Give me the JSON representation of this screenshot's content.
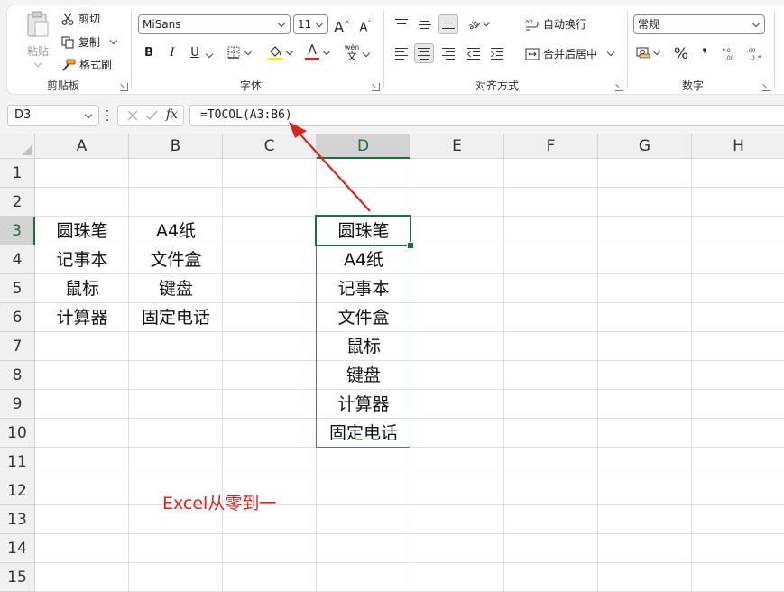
{
  "ribbon": {
    "clipboard": {
      "paste_label": "粘贴",
      "cut_label": "剪切",
      "copy_label": "复制",
      "format_painter_label": "格式刷",
      "group_label": "剪贴板"
    },
    "font": {
      "font_name": "MiSans",
      "font_size": "11",
      "grow_label": "A",
      "shrink_label": "A",
      "bold_label": "B",
      "italic_label": "I",
      "underline_label": "U",
      "font_color_glyph": "A",
      "phonetic_glyph": "wén",
      "phonetic_sub": "文",
      "group_label": "字体",
      "fill_color": "#FFE600",
      "font_color": "#E02020"
    },
    "alignment": {
      "wrap_text_label": "自动换行",
      "merge_center_label": "合并后居中",
      "group_label": "对齐方式"
    },
    "number": {
      "format_value": "常规",
      "percent_label": "%",
      "comma_label": "❜",
      "group_label": "数字"
    }
  },
  "formula_bar": {
    "name_box": "D3",
    "fx_label": "fx",
    "formula": "=TOCOL(A3:B6)"
  },
  "grid": {
    "columns": [
      "A",
      "B",
      "C",
      "D",
      "E",
      "F",
      "G",
      "H"
    ],
    "rows": [
      "1",
      "2",
      "3",
      "4",
      "5",
      "6",
      "7",
      "8",
      "9",
      "10",
      "11",
      "12",
      "13",
      "14",
      "15"
    ],
    "active_column": "D",
    "active_row": "3",
    "source_table": [
      [
        "圆珠笔",
        "A4纸"
      ],
      [
        "记事本",
        "文件盒"
      ],
      [
        "鼠标",
        "键盘"
      ],
      [
        "计算器",
        "固定电话"
      ]
    ],
    "result_column": [
      "圆珠笔",
      "A4纸",
      "记事本",
      "文件盒",
      "鼠标",
      "键盘",
      "计算器",
      "固定电话"
    ]
  },
  "watermark": "Excel从零到一",
  "colors": {
    "accent_green": "#1E6B3C",
    "annotation_red": "#D9261C",
    "result_border": "#4A72A8"
  }
}
